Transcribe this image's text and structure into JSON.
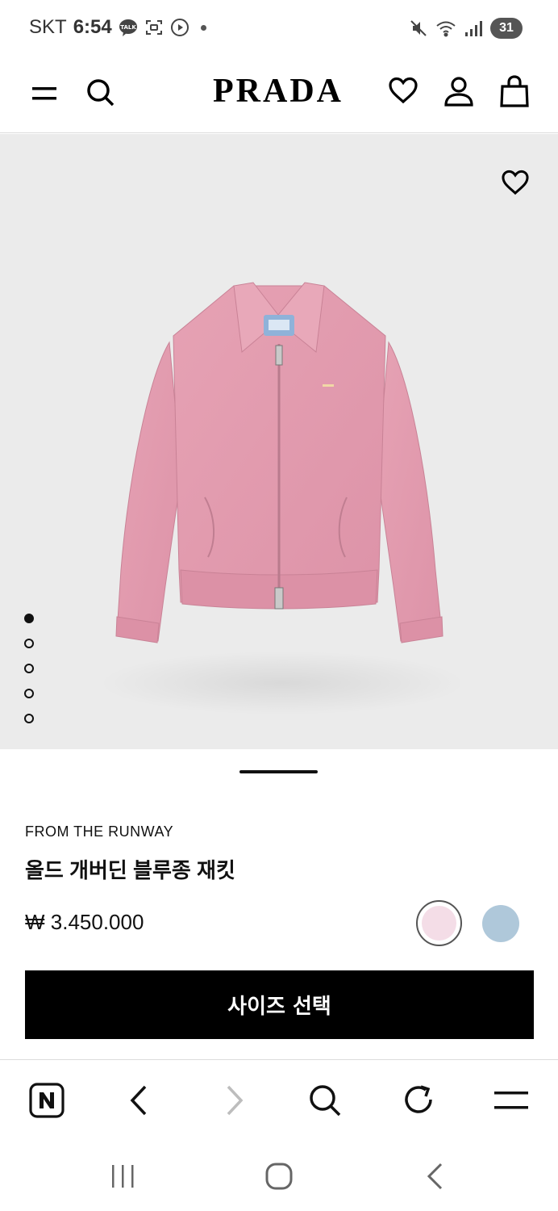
{
  "status_bar": {
    "carrier": "SKT",
    "time": "6:54",
    "talk_badge": "TALK",
    "battery": "31"
  },
  "header": {
    "logo": "PRADA",
    "icons": [
      "menu-icon",
      "search-icon",
      "heart-icon",
      "account-icon",
      "shopping-bag-icon"
    ]
  },
  "hero": {
    "image_count": 5,
    "active_index": 0
  },
  "product": {
    "collection": "FROM THE RUNWAY",
    "name": "올드 개버딘 블루종 재킷",
    "price": "₩ 3.450.000",
    "colors": [
      {
        "name": "pink",
        "hex": "#f4dde7",
        "selected": true
      },
      {
        "name": "light-blue",
        "hex": "#afc8da",
        "selected": false
      }
    ]
  },
  "cta": {
    "label": "사이즈 선택"
  },
  "browser_toolbar": {
    "icons": [
      "naver-icon",
      "back-icon",
      "forward-icon",
      "search-icon",
      "refresh-icon",
      "menu-icon"
    ]
  },
  "colors": {
    "hero_bg": "#ebebeb",
    "jacket": "#e39aae",
    "cta_bg": "#000000"
  }
}
